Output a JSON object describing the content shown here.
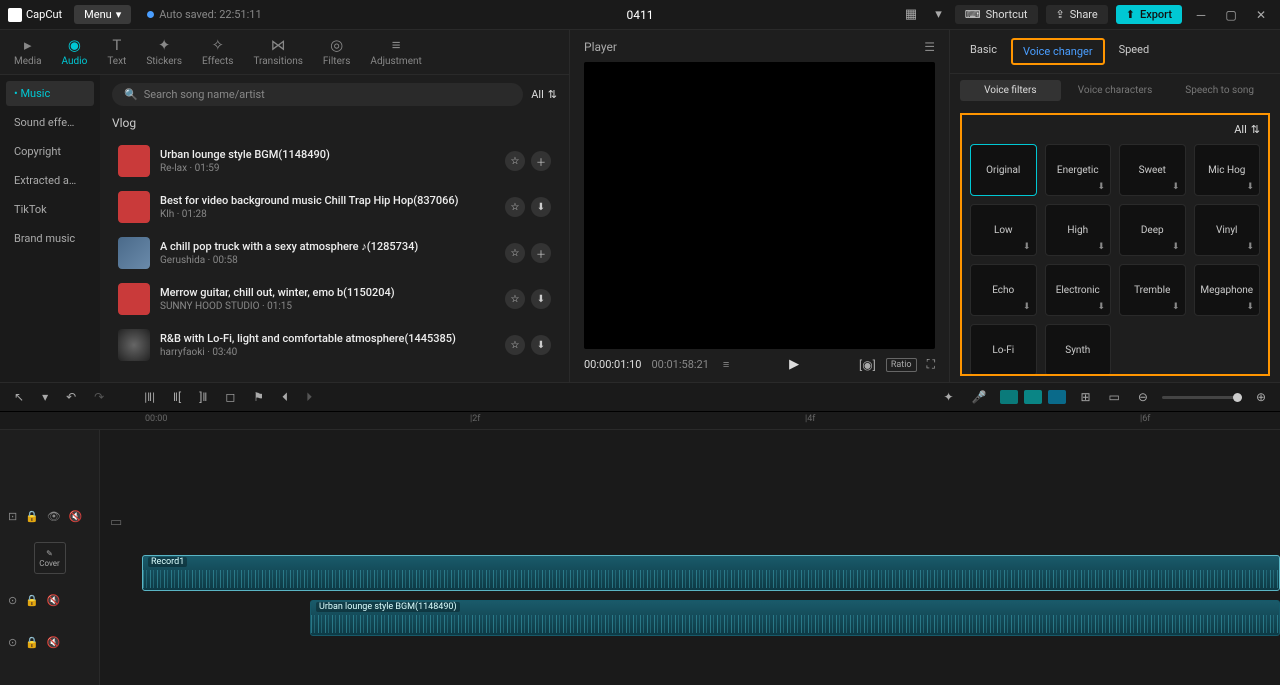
{
  "titlebar": {
    "logo": "CapCut",
    "menu": "Menu",
    "autosave": "Auto saved: 22:51:11",
    "project": "0411",
    "shortcut": "Shortcut",
    "share": "Share",
    "export": "Export"
  },
  "nav": {
    "tabs": [
      {
        "label": "Media"
      },
      {
        "label": "Audio"
      },
      {
        "label": "Text"
      },
      {
        "label": "Stickers"
      },
      {
        "label": "Effects"
      },
      {
        "label": "Transitions"
      },
      {
        "label": "Filters"
      },
      {
        "label": "Adjustment"
      }
    ]
  },
  "cats": [
    {
      "label": "Music"
    },
    {
      "label": "Sound effe…"
    },
    {
      "label": "Copyright"
    },
    {
      "label": "Extracted a…"
    },
    {
      "label": "TikTok"
    },
    {
      "label": "Brand music"
    }
  ],
  "search": {
    "placeholder": "Search song name/artist",
    "all": "All"
  },
  "section": "Vlog",
  "songs": [
    {
      "title": "Urban lounge style BGM(1148490)",
      "artist": "Re-lax",
      "dur": "01:59",
      "plus": true
    },
    {
      "title": "Best for video background music Chill Trap Hip Hop(837066)",
      "artist": "Klh",
      "dur": "01:28",
      "plus": false
    },
    {
      "title": "A chill pop truck with a sexy atmosphere ♪(1285734)",
      "artist": "Gerushida",
      "dur": "00:58",
      "plus": true
    },
    {
      "title": "Merrow guitar, chill out, winter, emo b(1150204)",
      "artist": "SUNNY HOOD STUDIO",
      "dur": "01:15",
      "plus": false
    },
    {
      "title": "R&B with Lo-Fi, light and comfortable atmosphere(1445385)",
      "artist": "harryfaoki",
      "dur": "03:40",
      "plus": false
    }
  ],
  "player": {
    "title": "Player",
    "current": "00:00:01:10",
    "total": "00:01:58:21",
    "ratio": "Ratio"
  },
  "right": {
    "tabs": {
      "basic": "Basic",
      "voice": "Voice changer",
      "speed": "Speed"
    },
    "sub": {
      "filters": "Voice filters",
      "chars": "Voice characters",
      "s2s": "Speech to song"
    },
    "all": "All",
    "voices": [
      "Original",
      "Energetic",
      "Sweet",
      "Mic Hog",
      "Low",
      "High",
      "Deep",
      "Vinyl",
      "Echo",
      "Electronic",
      "Tremble",
      "Megaphone",
      "Lo-Fi",
      "Synth"
    ]
  },
  "cover": "Cover",
  "ruler": {
    "t0": "00:00",
    "t1": "|2f",
    "t2": "|4f",
    "t3": "|6f"
  },
  "clips": {
    "rec": "Record1",
    "bgm": "Urban lounge style BGM(1148490)"
  }
}
